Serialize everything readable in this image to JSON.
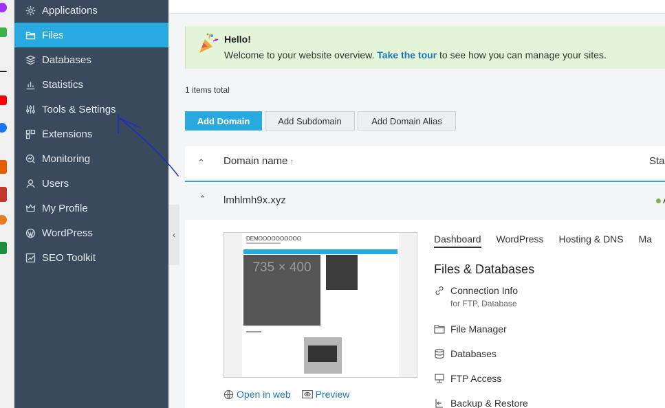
{
  "taskbar": {
    "icons": [
      {
        "name": "messenger-icon",
        "color": "#a033ff"
      },
      {
        "name": "green-app-icon",
        "color": "#3fb14a"
      },
      {
        "name": "dash-icon",
        "color": "#222222"
      },
      {
        "name": "youtube-icon",
        "color": "#ff0000"
      },
      {
        "name": "facebook-icon",
        "color": "#1877f2"
      },
      {
        "name": "app-orange-icon",
        "color": "#e65c00"
      },
      {
        "name": "app-red-icon",
        "color": "#c0392b"
      },
      {
        "name": "colorful-app-icon",
        "color": "#e67e22"
      },
      {
        "name": "sheets-icon",
        "color": "#1e8e3e"
      }
    ]
  },
  "sidebar": {
    "items": [
      {
        "label": "Applications",
        "icon": "gear-icon",
        "active": false
      },
      {
        "label": "Files",
        "icon": "folder-icon",
        "active": true
      },
      {
        "label": "Databases",
        "icon": "database-icon",
        "active": false
      },
      {
        "label": "Statistics",
        "icon": "bar-chart-icon",
        "active": false
      },
      {
        "label": "Tools & Settings",
        "icon": "sliders-icon",
        "active": false
      },
      {
        "label": "Extensions",
        "icon": "puzzle-icon",
        "active": false
      },
      {
        "label": "Monitoring",
        "icon": "monitor-search-icon",
        "active": false
      },
      {
        "label": "Users",
        "icon": "user-icon",
        "active": false
      },
      {
        "label": "My Profile",
        "icon": "crown-icon",
        "active": false
      },
      {
        "label": "WordPress",
        "icon": "wordpress-icon",
        "active": false
      },
      {
        "label": "SEO Toolkit",
        "icon": "seo-chart-icon",
        "active": false
      }
    ],
    "colors": {
      "background": "#3a4a5c",
      "active": "#28aae1"
    }
  },
  "hello": {
    "title": "Hello!",
    "msg_before": "Welcome to your website overview.",
    "tour_link": "Take the tour",
    "msg_after": "to see how you can manage your sites."
  },
  "items_total": "1 items total",
  "buttons": {
    "add_domain": "Add Domain",
    "add_subdomain": "Add Subdomain",
    "add_alias": "Add Domain Alias"
  },
  "table": {
    "col_domain": "Domain name",
    "sort_arrow": "↑",
    "col_status": "Stat"
  },
  "domain": {
    "name": "lmhlmh9x.xyz",
    "status": "A",
    "status_color": "#7cb342"
  },
  "preview": {
    "site_title": "DEMOOOOOOOOOO",
    "hero_text": "735 × 400",
    "open_in_web": "Open in web",
    "preview": "Preview"
  },
  "tabs": [
    {
      "label": "Dashboard",
      "active": true
    },
    {
      "label": "WordPress",
      "active": false
    },
    {
      "label": "Hosting & DNS",
      "active": false
    },
    {
      "label": "Ma",
      "active": false
    }
  ],
  "files_databases": {
    "title": "Files & Databases",
    "tools": [
      {
        "label": "Connection Info",
        "sub": "for FTP, Database",
        "icon": "link-icon"
      },
      {
        "label": "File Manager",
        "sub": "",
        "icon": "folder-icon"
      },
      {
        "label": "Databases",
        "sub": "",
        "icon": "database-icon"
      },
      {
        "label": "FTP Access",
        "sub": "",
        "icon": "ftp-icon"
      },
      {
        "label": "Backup & Restore",
        "sub": "",
        "icon": "backup-icon"
      }
    ]
  }
}
